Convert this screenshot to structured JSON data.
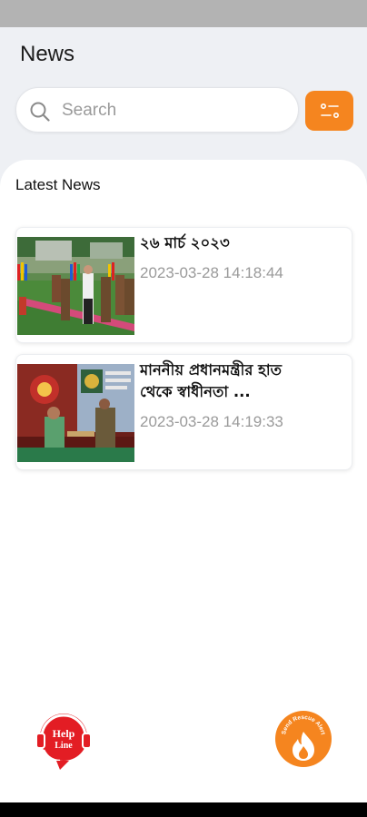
{
  "header": {
    "title": "News"
  },
  "search": {
    "placeholder": "Search"
  },
  "section": {
    "title": "Latest News"
  },
  "news": [
    {
      "title": "২৬ মার্চ ২০২৩",
      "date": "2023-03-28 14:18:44"
    },
    {
      "title_line1": "মাননীয় প্রধানমন্ত্রীর হাত",
      "title_line2": "থেকে  স্বাধীনতা ...",
      "date": "2023-03-28 14:19:33"
    }
  ],
  "fabs": {
    "help_line_1": "Help",
    "help_line_2": "Line",
    "fire_text": "Send Rescue Alert"
  },
  "colors": {
    "accent": "#f5851f",
    "help_red": "#e31d24",
    "panel": "#ffffff",
    "background": "#eef0f4"
  }
}
